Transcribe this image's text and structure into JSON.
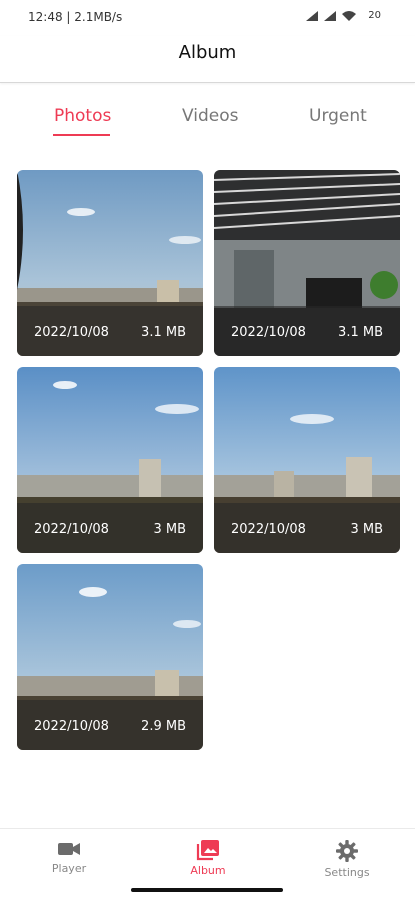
{
  "status_bar": {
    "time_speed": "12:48 | 2.1MB/s",
    "battery": "20"
  },
  "header": {
    "title": "Album"
  },
  "tabs": [
    {
      "label": "Photos",
      "active": true
    },
    {
      "label": "Videos",
      "active": false
    },
    {
      "label": "Urgent",
      "active": false
    }
  ],
  "photos": [
    {
      "date": "2022/10/08",
      "size": "3.1 MB",
      "scene": "sky-cityscape"
    },
    {
      "date": "2022/10/08",
      "size": "3.1 MB",
      "scene": "office-interior"
    },
    {
      "date": "2022/10/08",
      "size": "3 MB",
      "scene": "sky-cityscape"
    },
    {
      "date": "2022/10/08",
      "size": "3 MB",
      "scene": "sky-cityscape"
    },
    {
      "date": "2022/10/08",
      "size": "2.9 MB",
      "scene": "sky-cityscape"
    }
  ],
  "bottom_nav": [
    {
      "label": "Player",
      "icon": "video-camera-icon",
      "active": false
    },
    {
      "label": "Album",
      "icon": "album-icon",
      "active": true
    },
    {
      "label": "Settings",
      "icon": "gear-icon",
      "active": false
    }
  ],
  "colors": {
    "accent": "#ee3b54",
    "inactive": "#888888",
    "caption_overlay": "rgba(40,40,40,0.6)"
  }
}
